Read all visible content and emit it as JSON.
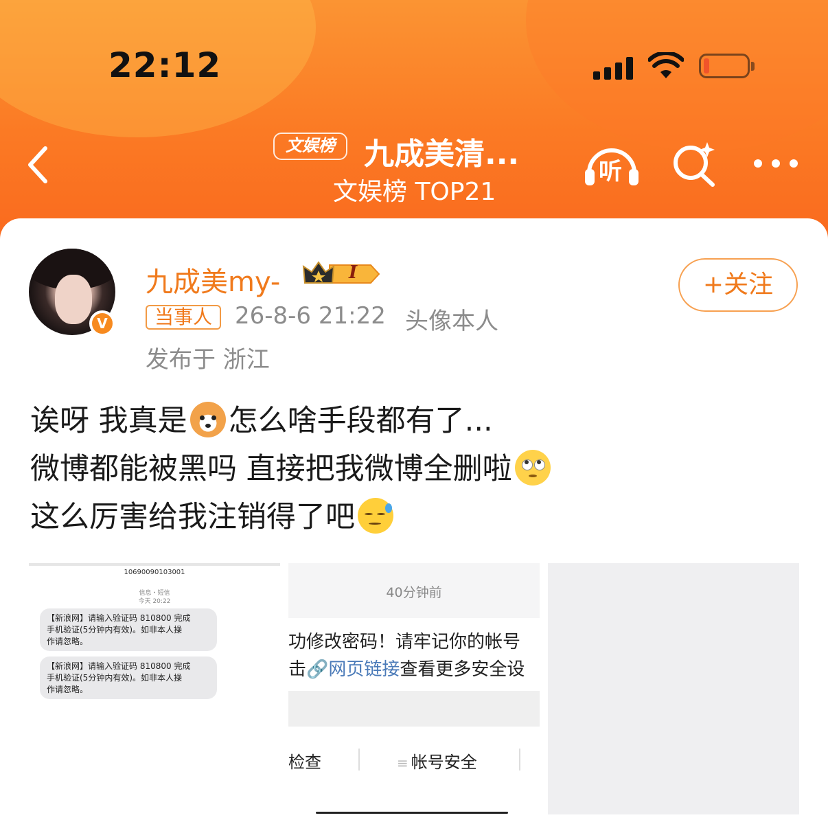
{
  "status_bar": {
    "time": "22:12"
  },
  "nav": {
    "tag": "文娱榜",
    "title": "九成美清...",
    "subtitle": "文娱榜 TOP21",
    "listen_label": "听"
  },
  "post": {
    "author": {
      "name": "九成美my-",
      "verified_mark": "V",
      "level_badge": "I",
      "role_badge": "当事人"
    },
    "follow_label": "+关注",
    "timestamp": "26-8-6 21:22",
    "source": "头像本人",
    "location": "发布于 浙江",
    "lines": [
      {
        "before": "诶呀 我真是",
        "emoji": "dog-emoji",
        "after": "怎么啥手段都有了..."
      },
      {
        "before": "微博都能被黑吗 直接把我微博全删啦",
        "emoji": "eye-roll-emoji",
        "after": ""
      },
      {
        "before": "这么厉害给我注销得了吧",
        "emoji": "sweat-emoji",
        "after": ""
      }
    ],
    "images": {
      "sms": {
        "sender_number": "10690090103001",
        "thread_label": "信息・短信",
        "thread_time": "今天 20:22",
        "messages": [
          {
            "line1": "【新浪网】请输入验证码 810800 完成",
            "line2": "手机验证(5分钟内有效)。如非本人操",
            "line3": "作请忽略。"
          },
          {
            "line1": "【新浪网】请输入验证码 810800 完成",
            "line2": "手机验证(5分钟内有效)。如非本人操",
            "line3": "作请忽略。"
          }
        ]
      },
      "notice": {
        "time": "40分钟前",
        "line1": "功修改密码！请牢记你的帐号",
        "line2_prefix": "击",
        "line2_link": "网页链接",
        "line2_suffix": "查看更多安全设",
        "footer_left": "检查",
        "footer_right": "帐号安全"
      }
    }
  },
  "colors": {
    "header_orange": "#fb7a24",
    "accent_orange": "#f07a1c",
    "meta_gray": "#8c8c8c",
    "link_blue": "#4a7ab8"
  }
}
